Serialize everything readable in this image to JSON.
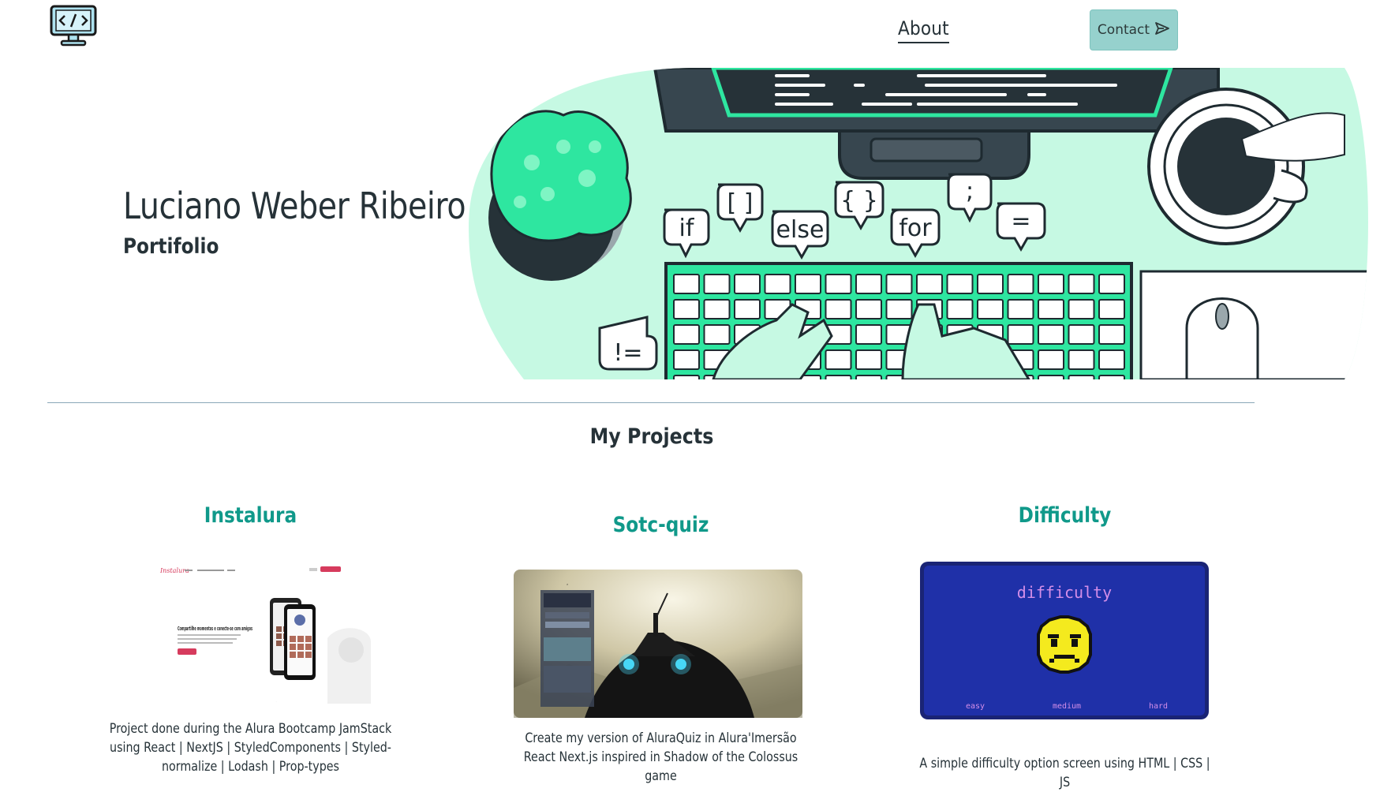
{
  "header": {
    "logo_icon": "code-monitor-icon",
    "nav": {
      "about_label": "About"
    },
    "contact": {
      "label": "Contact",
      "icon": "send-icon"
    }
  },
  "hero": {
    "name": "Luciano Weber Ribeiro",
    "subtitle": "Portifolio",
    "illustration": {
      "bubbles": [
        "if",
        "[ ]",
        "else",
        "{ }",
        "for",
        ";",
        "=",
        "!="
      ]
    }
  },
  "projects": {
    "title": "My Projects",
    "items": [
      {
        "title": "Instalura",
        "description": "Project done during the Alura Bootcamp JamStack using React | NextJS | StyledComponents | Styled-normalize | Lodash | Prop-types",
        "thumb": {
          "logo": "Instalura",
          "headline": "Compartilhe momentos e conecte-se com amigos",
          "cta": "Cadastrar"
        }
      },
      {
        "title": "Sotc-quiz",
        "description": "Create my version of AluraQuiz in Alura'Imersão React Next.js inspired in Shadow of the Colossus game",
        "thumb": {}
      },
      {
        "title": "Difficulty",
        "description": "A simple difficulty option screen using HTML | CSS | JS",
        "thumb": {
          "heading": "difficulty",
          "options": [
            "easy",
            "medium",
            "hard"
          ]
        }
      }
    ]
  },
  "colors": {
    "accent": "#10998a",
    "contact_bg": "#96d1cd",
    "mint": "#c6f9e3",
    "green": "#2ee6a0",
    "text": "#263238"
  }
}
